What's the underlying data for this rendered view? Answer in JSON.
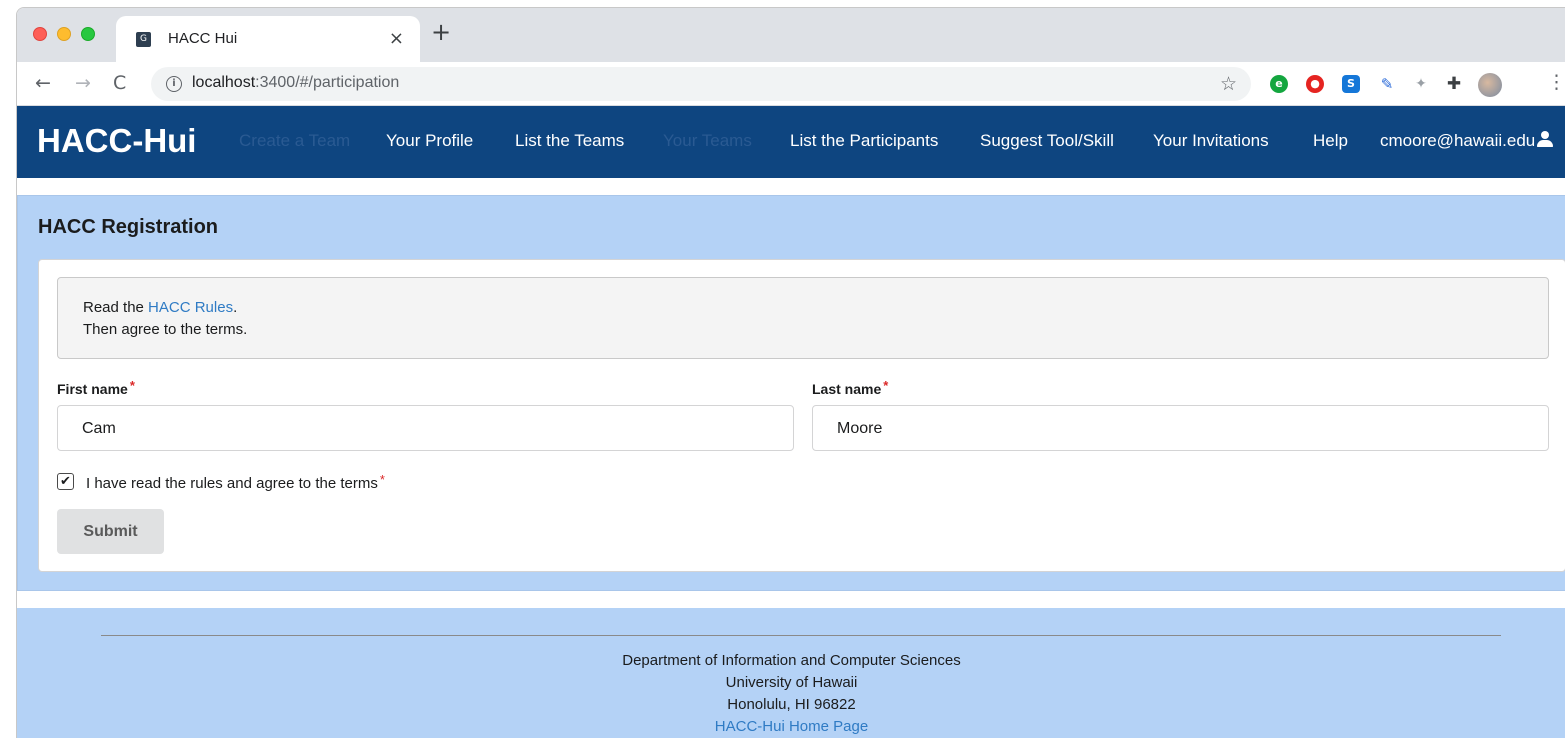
{
  "browser": {
    "tab_title": "HACC Hui",
    "tab_favicon_glyph": "G",
    "close_glyph": "×",
    "new_tab_glyph": "+",
    "back_glyph": "←",
    "forward_glyph": "→",
    "reload_glyph": "C",
    "info_glyph": "i",
    "url_host": "localhost",
    "url_path": ":3400/#/participation",
    "star_glyph": "☆",
    "menu_glyph": "⋮",
    "extensions": {
      "evernote_glyph": "e",
      "stop_glyph": "●",
      "s_glyph": "S",
      "dropper_glyph": "✎",
      "dropbox_glyph": "✦",
      "puzzle_glyph": "✚"
    }
  },
  "navbar": {
    "brand": "HACC-Hui",
    "links": {
      "create_team": "Create a Team",
      "your_profile": "Your Profile",
      "list_teams": "List the Teams",
      "your_teams": "Your Teams",
      "list_participants": "List the Participants",
      "suggest_tool": "Suggest Tool/Skill",
      "your_invitations": "Your Invitations",
      "help": "Help",
      "user": "cmoore@hawaii.edu"
    }
  },
  "registration": {
    "title": "HACC Registration",
    "message": {
      "line1_prefix": "Read the ",
      "rules_link": "HACC Rules",
      "line1_suffix": ".",
      "line2": "Then agree to the terms."
    },
    "first_name_label": "First name",
    "first_name_value": "Cam",
    "last_name_label": "Last name",
    "last_name_value": "Moore",
    "required_marker": "*",
    "checkbox_checked_glyph": "✔",
    "checkbox_label": "I have read the rules and agree to the terms",
    "submit_label": "Submit"
  },
  "footer": {
    "line1": "Department of Information and Computer Sciences",
    "line2": "University of Hawaii",
    "line3": "Honolulu, HI 96822",
    "home_link": "HACC-Hui Home Page"
  },
  "colors": {
    "navbar_bg": "#0e4580",
    "segment_bg": "#b4d2f6",
    "link": "#2f7bc4",
    "required": "#db2828"
  }
}
